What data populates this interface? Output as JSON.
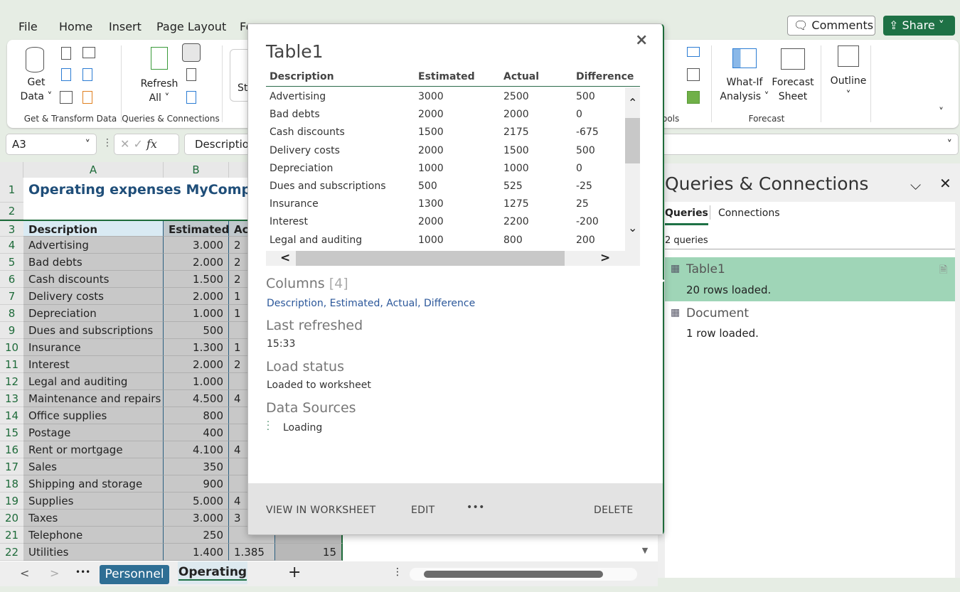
{
  "menu": [
    "File",
    "Home",
    "Insert",
    "Page Layout",
    "Fo"
  ],
  "header": {
    "comments": "Comments",
    "share": "Share"
  },
  "ribbon": {
    "get_data": [
      "Get",
      "Data ˅"
    ],
    "group1": "Get & Transform Data",
    "refresh": [
      "Refresh",
      "All ˅"
    ],
    "group2": "Queries & Connections",
    "st": "St",
    "tools_fragment": "ools",
    "whatif": [
      "What-If",
      "Analysis ˅"
    ],
    "forecast_sheet": [
      "Forecast",
      "Sheet"
    ],
    "group_forecast": "Forecast",
    "outline": "Outline"
  },
  "formula": {
    "name_box": "A3",
    "fx": "fx",
    "value": "Description"
  },
  "sheet": {
    "columns": [
      "A",
      "B"
    ],
    "title": "Operating expenses MyCompany",
    "headers": [
      "Description",
      "Estimated",
      "Ac"
    ],
    "rows": [
      [
        "Advertising",
        "3.000",
        "2",
        ""
      ],
      [
        "Bad debts",
        "2.000",
        "2",
        ""
      ],
      [
        "Cash discounts",
        "1.500",
        "2",
        ""
      ],
      [
        "Delivery costs",
        "2.000",
        "1",
        ""
      ],
      [
        "Depreciation",
        "1.000",
        "1",
        ""
      ],
      [
        "Dues and subscriptions",
        "500",
        "",
        ""
      ],
      [
        "Insurance",
        "1.300",
        "1",
        ""
      ],
      [
        "Interest",
        "2.000",
        "2",
        ""
      ],
      [
        "Legal and auditing",
        "1.000",
        "",
        ""
      ],
      [
        "Maintenance and repairs",
        "4.500",
        "4",
        ""
      ],
      [
        "Office supplies",
        "800",
        "",
        ""
      ],
      [
        "Postage",
        "400",
        "",
        ""
      ],
      [
        "Rent or mortgage",
        "4.100",
        "4",
        ""
      ],
      [
        "Sales",
        "350",
        "",
        ""
      ],
      [
        "Shipping and storage",
        "900",
        "",
        ""
      ],
      [
        "Supplies",
        "5.000",
        "4",
        ""
      ],
      [
        "Taxes",
        "3.000",
        "3",
        ""
      ],
      [
        "Telephone",
        "250",
        "",
        ""
      ],
      [
        "Utilities",
        "1.400",
        "1.385",
        "15"
      ]
    ]
  },
  "sheet_tabs": {
    "tabs": [
      "Personnel",
      "Operating"
    ],
    "active": "Operating",
    "add": "+",
    "more": "•••"
  },
  "popup": {
    "title": "Table1",
    "columns": [
      "Description",
      "Estimated",
      "Actual",
      "Difference"
    ],
    "rows": [
      [
        "Advertising",
        "3000",
        "2500",
        "500"
      ],
      [
        "Bad debts",
        "2000",
        "2000",
        "0"
      ],
      [
        "Cash discounts",
        "1500",
        "2175",
        "-675"
      ],
      [
        "Delivery costs",
        "2000",
        "1500",
        "500"
      ],
      [
        "Depreciation",
        "1000",
        "1000",
        "0"
      ],
      [
        "Dues and subscriptions",
        "500",
        "525",
        "-25"
      ],
      [
        "Insurance",
        "1300",
        "1275",
        "25"
      ],
      [
        "Interest",
        "2000",
        "2200",
        "-200"
      ],
      [
        "Legal and auditing",
        "1000",
        "800",
        "200"
      ]
    ],
    "columns_heading": "Columns",
    "columns_count": "[4]",
    "columns_list": "Description, Estimated, Actual, Difference",
    "last_refreshed_heading": "Last refreshed",
    "last_refreshed": "15:33",
    "load_status_heading": "Load status",
    "load_status": "Loaded to worksheet",
    "data_sources_heading": "Data Sources",
    "data_sources": "Loading",
    "actions": {
      "view": "VIEW IN WORKSHEET",
      "edit": "EDIT",
      "more": "•••",
      "delete": "DELETE"
    }
  },
  "panel": {
    "title": "Queries & Connections",
    "tabs": [
      "Queries",
      "Connections"
    ],
    "count": "2 queries",
    "queries": [
      {
        "name": "Table1",
        "status": "20 rows loaded."
      },
      {
        "name": "Document",
        "status": "1 row loaded."
      }
    ]
  },
  "colors": {
    "accent": "#1e7145",
    "selected": "#9fd5b7",
    "link": "#2b579a",
    "title": "#1f4e79"
  }
}
